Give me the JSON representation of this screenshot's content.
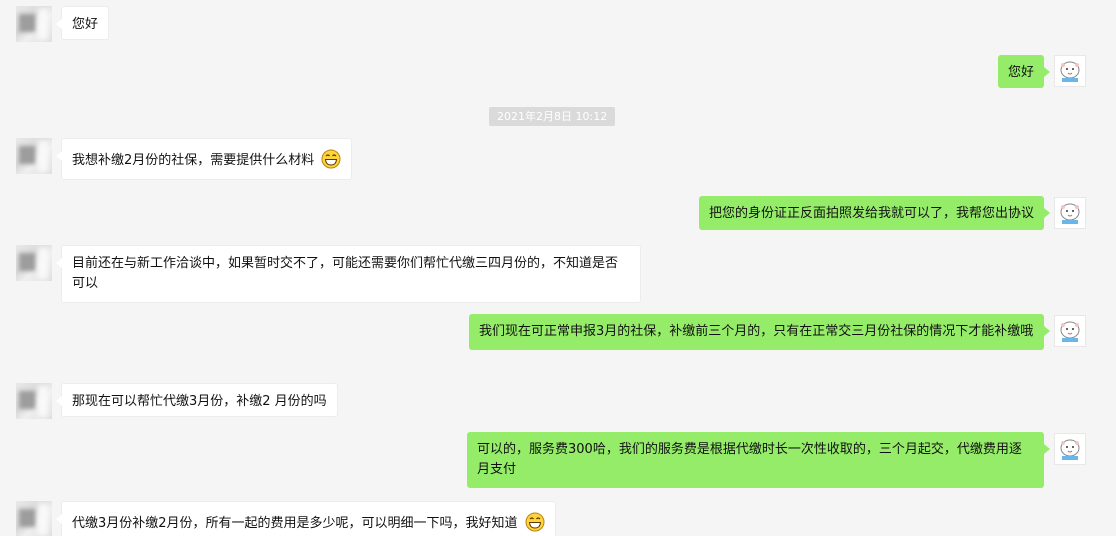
{
  "timestamp": "2021年2月8日 10:12",
  "icons": {
    "contact_avatar": "blurred-avatar-icon",
    "self_avatar": "cartoon-sheep-avatar-icon",
    "emoji": "grin-emoji-icon"
  },
  "colors": {
    "background": "#f5f5f5",
    "incoming_bubble": "#ffffff",
    "outgoing_bubble": "#95ec69",
    "timestamp_bg": "#dadada"
  },
  "messages": [
    {
      "side": "left",
      "text": "您好"
    },
    {
      "side": "right",
      "text": "您好"
    },
    {
      "side": "left",
      "text": "我想补缴2月份的社保，需要提供什么材料",
      "emoji": true
    },
    {
      "side": "right",
      "text": "把您的身份证正反面拍照发给我就可以了，我帮您出协议"
    },
    {
      "side": "left",
      "text": "目前还在与新工作洽谈中，如果暂时交不了，可能还需要你们帮忙代缴三四月份的，不知道是否可以"
    },
    {
      "side": "right",
      "text": "我们现在可正常申报3月的社保，补缴前三个月的，只有在正常交三月份社保的情况下才能补缴哦"
    },
    {
      "side": "left",
      "text": "那现在可以帮忙代缴3月份，补缴2 月份的吗"
    },
    {
      "side": "right",
      "text": "可以的，服务费300哈，我们的服务费是根据代缴时长一次性收取的，三个月起交，代缴费用逐月支付"
    },
    {
      "side": "left",
      "text": "代缴3月份补缴2月份，所有一起的费用是多少呢，可以明细一下吗，我好知道",
      "emoji": true
    }
  ]
}
